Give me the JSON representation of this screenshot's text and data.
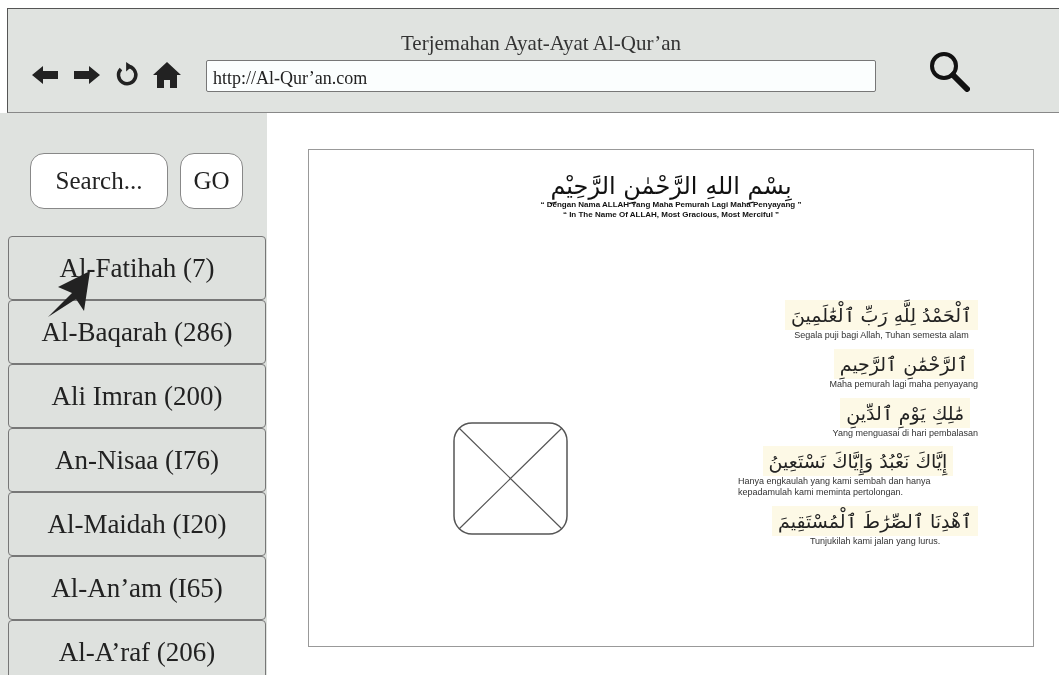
{
  "browser": {
    "title": "Terjemahan Ayat-Ayat Al-Qur’an",
    "url": "http://Al-Qur’an.com"
  },
  "sidebar": {
    "search": {
      "placeholder": "Search..."
    },
    "go_button": "GO",
    "items": [
      {
        "label": "Al-Fatihah (7)",
        "pointer": true
      },
      {
        "label": "Al-Baqarah (286)",
        "pointer": false
      },
      {
        "label": "Ali Imran (200)",
        "pointer": false
      },
      {
        "label": "An-Nisaa (I76)",
        "pointer": false
      },
      {
        "label": "Al-Maidah (I20)",
        "pointer": false
      },
      {
        "label": "Al-An’am (I65)",
        "pointer": false
      },
      {
        "label": "Al-A’raf (206)",
        "pointer": false
      }
    ]
  },
  "content": {
    "basmala": "بِسْمِ اللهِ الرَّحْمٰنِ الرَّحِيْمِ",
    "basmala_translations": [
      "“ Dengan Nama ALLAH Yang Maha Pemurah Lagi Maha Penyayang ”",
      "“ In The Name Of ALLAH, Most Gracious, Most Merciful ”"
    ],
    "image": {
      "kind": "placeholder"
    },
    "verses": [
      {
        "arabic": "ٱلْحَمْدُ لِلَّهِ رَبِّ ٱلْعَٰلَمِينَ",
        "translation": "Segala puji bagi Allah, Tuhan semesta alam"
      },
      {
        "arabic": "ٱلرَّحْمَٰنِ ٱلرَّحِيمِ",
        "translation": "Maha pemurah lagi maha penyayang"
      },
      {
        "arabic": "مَٰلِكِ يَوْمِ ٱلدِّينِ",
        "translation": "Yang menguasai di hari pembalasan"
      },
      {
        "arabic": "إِيَّاكَ نَعْبُدُ وَإِيَّاكَ نَسْتَعِينُ",
        "translation": "Hanya engkaulah yang kami sembah dan hanya kepadamulah kami meminta pertolongan."
      },
      {
        "arabic": "ٱهْدِنَا ٱلصِّرَٰطَ ٱلْمُسْتَقِيمَ",
        "translation": "Tunjukilah kami jalan yang lurus."
      }
    ]
  }
}
